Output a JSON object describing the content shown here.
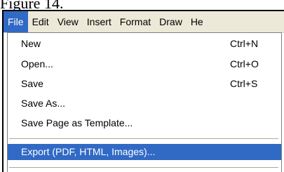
{
  "document": {
    "caption": "Figure 14."
  },
  "menubar": {
    "items": [
      {
        "label": "File",
        "active": true
      },
      {
        "label": "Edit"
      },
      {
        "label": "View"
      },
      {
        "label": "Insert"
      },
      {
        "label": "Format"
      },
      {
        "label": "Draw"
      },
      {
        "label": "He"
      }
    ]
  },
  "file_menu": {
    "items": [
      {
        "label": "New",
        "shortcut": "Ctrl+N"
      },
      {
        "label": "Open...",
        "shortcut": "Ctrl+O"
      },
      {
        "label": "Save",
        "shortcut": "Ctrl+S"
      },
      {
        "label": "Save As...",
        "shortcut": ""
      },
      {
        "label": "Save Page as Template...",
        "shortcut": ""
      },
      {
        "label": "Export (PDF, HTML, Images)...",
        "shortcut": "",
        "highlighted": true
      }
    ]
  },
  "colors": {
    "menubar_bg": "#ece9d8",
    "highlight": "#316ac5",
    "menu_bg": "#ffffff"
  }
}
